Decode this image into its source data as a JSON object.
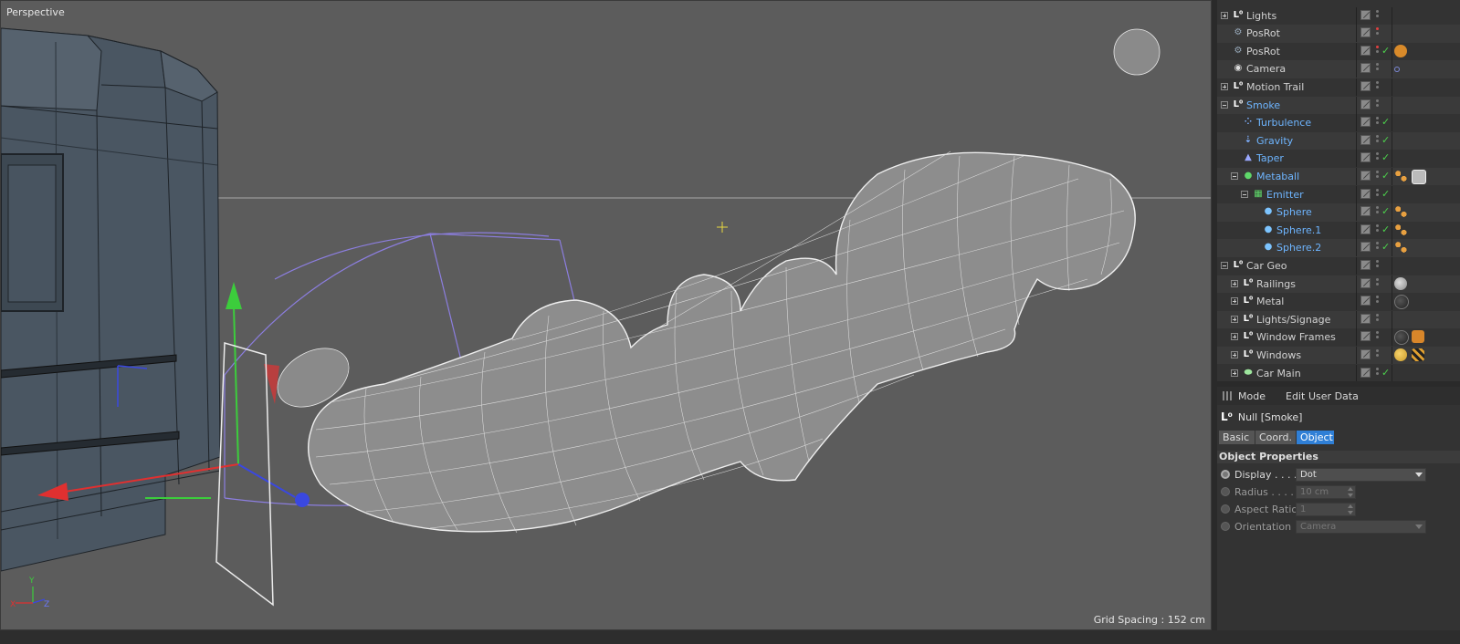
{
  "viewport": {
    "title": "Perspective",
    "grid_spacing": "Grid Spacing : 152 cm",
    "axis_labels": {
      "x": "X",
      "y": "Y",
      "z": "Z"
    }
  },
  "object_manager": {
    "items": [
      {
        "label": "Lights",
        "icon": "null-icon",
        "depth": 0,
        "expander": "plus",
        "color": "normal"
      },
      {
        "label": "PosRot",
        "icon": "xpresso-icon",
        "depth": 0,
        "expander": "none",
        "color": "normal",
        "tags": [
          "red-dot"
        ]
      },
      {
        "label": "PosRot",
        "icon": "xpresso-icon",
        "depth": 0,
        "expander": "none",
        "color": "normal",
        "tags": [
          "red-dot",
          "check",
          "stop-tag"
        ]
      },
      {
        "label": "Camera",
        "icon": "camera-icon",
        "depth": 0,
        "expander": "none",
        "color": "normal",
        "tags": [
          "target-tag"
        ]
      },
      {
        "label": "Motion Trail",
        "icon": "null-icon",
        "depth": 0,
        "expander": "plus",
        "color": "normal"
      },
      {
        "label": "Smoke",
        "icon": "null-icon",
        "depth": 0,
        "expander": "minus",
        "color": "blue"
      },
      {
        "label": "Turbulence",
        "icon": "turbulence-icon",
        "depth": 1,
        "expander": "none",
        "color": "blue",
        "tags": [
          "check"
        ]
      },
      {
        "label": "Gravity",
        "icon": "gravity-icon",
        "depth": 1,
        "expander": "none",
        "color": "blue",
        "tags": [
          "check"
        ]
      },
      {
        "label": "Taper",
        "icon": "taper-icon",
        "depth": 1,
        "expander": "none",
        "color": "blue",
        "tags": [
          "check"
        ]
      },
      {
        "label": "Metaball",
        "icon": "metaball-icon",
        "depth": 1,
        "expander": "minus",
        "color": "blue",
        "tags": [
          "check",
          "material-dots",
          "sphere-tag"
        ]
      },
      {
        "label": "Emitter",
        "icon": "emitter-icon",
        "depth": 2,
        "expander": "minus",
        "color": "blue",
        "tags": [
          "check"
        ]
      },
      {
        "label": "Sphere",
        "icon": "sphere-icon",
        "depth": 3,
        "expander": "none",
        "color": "blue",
        "tags": [
          "check",
          "material-dots"
        ]
      },
      {
        "label": "Sphere.1",
        "icon": "sphere-icon",
        "depth": 3,
        "expander": "none",
        "color": "blue",
        "tags": [
          "check",
          "material-dots"
        ]
      },
      {
        "label": "Sphere.2",
        "icon": "sphere-icon",
        "depth": 3,
        "expander": "none",
        "color": "blue",
        "tags": [
          "check",
          "material-dots"
        ]
      },
      {
        "label": "Car Geo",
        "icon": "null-icon",
        "depth": 0,
        "expander": "minus",
        "color": "normal"
      },
      {
        "label": "Railings",
        "icon": "null-icon",
        "depth": 1,
        "expander": "plus",
        "color": "normal",
        "tags": [
          "material-light"
        ]
      },
      {
        "label": "Metal",
        "icon": "null-icon",
        "depth": 1,
        "expander": "plus",
        "color": "normal",
        "tags": [
          "material-dark"
        ]
      },
      {
        "label": "Lights/Signage",
        "icon": "null-icon",
        "depth": 1,
        "expander": "plus",
        "color": "normal"
      },
      {
        "label": "Window Frames",
        "icon": "null-icon",
        "depth": 1,
        "expander": "plus",
        "color": "normal",
        "tags": [
          "material-dark",
          "material-orange"
        ]
      },
      {
        "label": "Windows",
        "icon": "null-icon",
        "depth": 1,
        "expander": "plus",
        "color": "normal",
        "tags": [
          "material-yellow",
          "clapper"
        ]
      },
      {
        "label": "Car Main",
        "icon": "capsule-icon",
        "depth": 1,
        "expander": "plus",
        "color": "normal",
        "tags": [
          "check"
        ]
      }
    ]
  },
  "attribute_manager": {
    "menu": [
      "Mode",
      "Edit",
      "User Data"
    ],
    "object_name": "Null [Smoke]",
    "tabs": [
      "Basic",
      "Coord.",
      "Object"
    ],
    "active_tab": "Object",
    "section_title": "Object Properties",
    "properties": [
      {
        "label": "Display . . . .",
        "value": "Dot",
        "type": "dropdown",
        "enabled": true
      },
      {
        "label": "Radius . . . .",
        "value": "10 cm",
        "type": "number",
        "enabled": false
      },
      {
        "label": "Aspect Ratio",
        "value": "1",
        "type": "number",
        "enabled": false
      },
      {
        "label": "Orientation",
        "value": "Camera",
        "type": "dropdown",
        "enabled": false
      }
    ]
  },
  "colors": {
    "viewport_bg": "#5c5c5c",
    "panel_bg": "#333333",
    "accent_blue": "#2f7fd6",
    "highlight_text": "#6eb5ff",
    "check_green": "#4cd04c"
  }
}
